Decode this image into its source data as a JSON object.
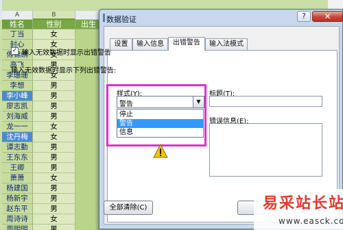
{
  "sheet": {
    "columns": [
      "A",
      "B"
    ],
    "headers": [
      "姓名",
      "性别",
      "出生"
    ],
    "rows": [
      {
        "name": "丁当",
        "sex": "女",
        "highlight": false
      },
      {
        "name": "封心",
        "sex": "女",
        "highlight": false
      },
      {
        "name": "傅锦绣",
        "sex": "女",
        "highlight": false
      },
      {
        "name": "高飞",
        "sex": "男",
        "highlight": false
      },
      {
        "name": "李珊珊",
        "sex": "女",
        "highlight": false
      },
      {
        "name": "李想",
        "sex": "男",
        "highlight": false
      },
      {
        "name": "李小峰",
        "sex": "男",
        "highlight": true
      },
      {
        "name": "廖志凯",
        "sex": "男",
        "highlight": false
      },
      {
        "name": "刘海威",
        "sex": "男",
        "highlight": false
      },
      {
        "name": "龙一一",
        "sex": "女",
        "highlight": false
      },
      {
        "name": "沈丹梅",
        "sex": "女",
        "highlight": true
      },
      {
        "name": "谭志勤",
        "sex": "男",
        "highlight": false
      },
      {
        "name": "王东东",
        "sex": "男",
        "highlight": false
      },
      {
        "name": "王卿",
        "sex": "男",
        "highlight": false
      },
      {
        "name": "萧萧",
        "sex": "女",
        "highlight": false
      },
      {
        "name": "杨建国",
        "sex": "男",
        "highlight": false
      },
      {
        "name": "杨新宇",
        "sex": "男",
        "highlight": false
      },
      {
        "name": "赵东平",
        "sex": "男",
        "highlight": false
      },
      {
        "name": "周诗诗",
        "sex": "女",
        "highlight": false
      },
      {
        "name": "周明明",
        "sex": "男",
        "highlight": false
      }
    ]
  },
  "dialog": {
    "title": "数据验证",
    "help": "?",
    "close": "✕",
    "tabs": [
      "设置",
      "输入信息",
      "出错警告",
      "输入法模式"
    ],
    "active_tab": 2,
    "checkbox_checked": true,
    "checkbox_mark": "✓",
    "checkbox_label": "输入无效数据时显示出错警告",
    "section_label": "输入无效数据时显示下列出错警告:",
    "style_label": "样式(Y):",
    "style_value": "警告",
    "style_options": [
      "停止",
      "警告",
      "信息"
    ],
    "selected_option": 1,
    "title_label": "标题(T):",
    "error_label": "错误信息(E):",
    "clear_button": "全部清除(C)",
    "dropdown_arrow": "▼"
  },
  "colors": {
    "highlight": "#e12ecb",
    "selected_item": "#3399ff",
    "name_cell_blue": "#4a8ad0"
  },
  "watermark": {
    "big": "易采站长站",
    "small": "www.easck.com"
  }
}
